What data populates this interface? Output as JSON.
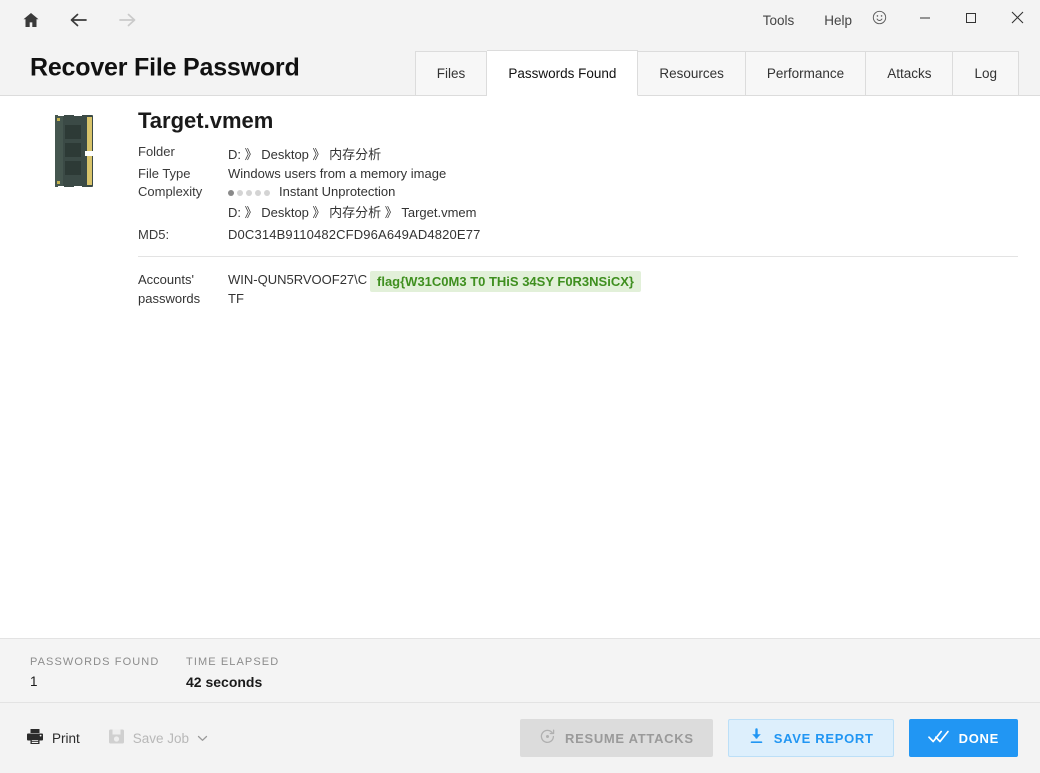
{
  "titlebar": {
    "nav": [
      {
        "name": "home-icon",
        "label": "Home"
      },
      {
        "name": "back-arrow-icon",
        "label": "Back"
      },
      {
        "name": "forward-arrow-icon",
        "label": "Forward"
      }
    ],
    "menu": [
      {
        "label": "Tools"
      },
      {
        "label": "Help"
      }
    ],
    "window_controls": [
      {
        "name": "feedback-smiley-icon",
        "label": "Feedback"
      },
      {
        "name": "minimize-icon",
        "label": "Minimize"
      },
      {
        "name": "maximize-icon",
        "label": "Maximize"
      },
      {
        "name": "close-icon",
        "label": "Close"
      }
    ]
  },
  "header": {
    "title": "Recover File Password",
    "tabs": [
      {
        "label": "Files",
        "active": false
      },
      {
        "label": "Passwords Found",
        "active": true
      },
      {
        "label": "Resources",
        "active": false
      },
      {
        "label": "Performance",
        "active": false
      },
      {
        "label": "Attacks",
        "active": false
      },
      {
        "label": "Log",
        "active": false
      }
    ]
  },
  "file": {
    "thumbnail_icon": "memory-module-icon",
    "name": "Target.vmem",
    "folder_label": "Folder",
    "folder_value": "D: 》 Desktop 》 内存分析",
    "filetype_label": "File Type",
    "filetype_value": "Windows users from a memory image",
    "complexity_label": "Complexity",
    "complexity_value": "Instant Unprotection",
    "complexity_dots_filled": 1,
    "complexity_dots_total": 5,
    "full_path": "D: 》 Desktop 》 内存分析 》 Target.vmem",
    "md5_label": "MD5:",
    "md5_value": "D0C314B9110482CFD96A649AD4820E77"
  },
  "accounts": {
    "label": "Accounts' passwords",
    "username": "WIN-QUN5RVOOF27\\CTF",
    "password": "flag{W31C0M3 T0 THiS 34SY F0R3NSiCX}",
    "password_color": "#3f8f1f",
    "password_bg": "#e2f0d9"
  },
  "status": {
    "passwords_found_label": "PASSWORDS FOUND",
    "passwords_found_value": "1",
    "time_elapsed_label": "TIME ELAPSED",
    "time_elapsed_value": "42 seconds"
  },
  "actions": {
    "print_label": "Print",
    "print_icon": "printer-icon",
    "save_job_label": "Save Job",
    "save_job_icon": "floppy-disk-icon",
    "save_job_caret_icon": "chevron-down-icon",
    "resume_label": "RESUME ATTACKS",
    "resume_icon": "refresh-circle-icon",
    "save_report_label": "SAVE REPORT",
    "save_report_icon": "download-icon",
    "done_label": "DONE",
    "done_icon": "double-check-icon",
    "accent_color": "#2196f3"
  }
}
